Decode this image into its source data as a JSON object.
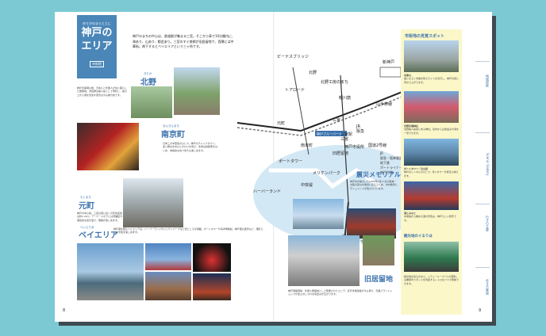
{
  "left_page": {
    "title_small": "めりかのまらととに",
    "title": "神戸のエリア",
    "area_tag": "市街地",
    "intro": "神戸のまちの中心は、鉄道駅が集まる三宮。そこから車で10分圏内に、海あり、山あり、都会あり。三宮のすぐ南側が旧居留地で、西隣には中華街。南下するとベイエリアという三ヶ所です。",
    "sections": {
      "kitano": {
        "ruby": "きたの",
        "heading": "北野",
        "text": "神戸を開港以後、日本人と外国人が共に暮らした居留地。洋館群は異人館として現存し、坂の上から港を見渡す風景は今も魅力的です。"
      },
      "nankinmachi": {
        "ruby": "なんきんまち",
        "heading": "南京町",
        "text": "日本三大中華街のひとつ。神戸のチャイナタウン。多い屋台を中心にぎわいを見せ、冬場は春節祭をはじめ、本格的な食べ歩きも楽しめます。"
      },
      "motomachi": {
        "ruby": "もとまち",
        "heading": "元町",
        "text": "神戸の中心街。三宮の西に続く元町商店街は約1.2km。アーケードの下には老舗店や個性的な店が並び、散策が楽しめます。"
      },
      "bayarea": {
        "ruby": "べいえりあ",
        "heading": "ベイエリア",
        "text": "神戸港を臨むベイエリアは、ハーバーランドやメリケンパークなど見どころが満載。ポートタワーや海洋博物館、神戸港の夜景など、港町らしい景色を楽しめます。"
      }
    },
    "page_number": "8"
  },
  "map": {
    "labels": [
      "ビーナスブリッジ",
      "北野",
      "北野工房のまち",
      "トアロード",
      "元町",
      "三宮",
      "JR",
      "阪急",
      "三宮",
      "旧居留地",
      "南京町",
      "メリケンパーク",
      "ポートタワー",
      "中突堤",
      "ハーバーランド",
      "ベイエリア",
      "神戸市役所",
      "三宮駅",
      "山手幹線",
      "国道2号線",
      "ポートアイランド北公園",
      "ポートアイランド",
      "新神戸",
      "鯉川筋"
    ],
    "legend": [
      "JR",
      "阪急・阪神電鉄",
      "地下鉄",
      "ポートライナー",
      "神戸空港"
    ],
    "station_box": "神戸ブルーバード"
  },
  "right_page": {
    "sections": {
      "memorial": {
        "heading": "震災メモリアル",
        "text": "神戸市が被災した1995年1月17日の阪神・淡路大震災を後世に伝えるため、市内各所にモニュメントが残されています。"
      },
      "kyukyoryuchi": {
        "heading": "旧居留地",
        "text": "神戸港開港後、外国人居留地として整備されたエリア。近代洋風建築が今も残り、高級ブランドショップが並ぶおしゃれな街並みが広がります。"
      }
    },
    "sidebar": {
      "title": "市街地の見覚スポット",
      "spots": [
        {
          "name": "市章山",
          "text": "夜になると市章を象るライトが点灯し、神戸の街に浮かび上がります。"
        },
        {
          "name": "北野天満神社",
          "text": "北野異人館街にある神社。境内からは街並みや海を一望できます。"
        },
        {
          "name": "ポートタワー／元山宮",
          "text": "神戸のシンボルのひとつ。赤いタワーが青空に映えます。"
        },
        {
          "name": "港とみなと",
          "text": "中突堤から眺める港の景色は、神戸らしい風景です。"
        }
      ],
      "sub_heading": "観光地のぐるりは",
      "sub_text": "観光地を巡るのなら、シティーループバスが便利。主要観光スポットを周遊するレトロなバスで移動できます。"
    },
    "tabs": [
      "地域探索",
      "Scenic Gallery",
      "行きの主要",
      "歩き方実践"
    ],
    "page_number": "9"
  }
}
